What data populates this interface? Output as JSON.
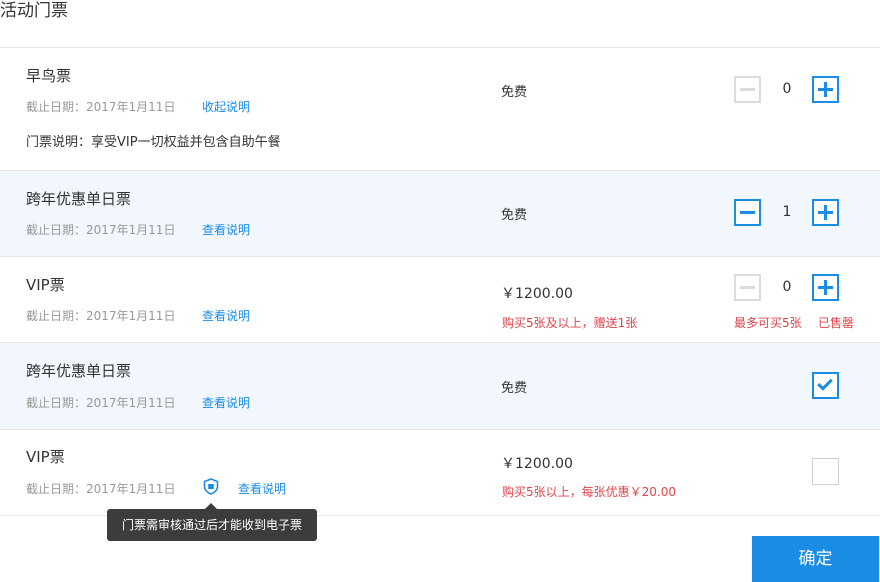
{
  "page": {
    "title": "活动门票"
  },
  "tickets": [
    {
      "name": "早鸟票",
      "deadline": "截止日期：2017年1月11日",
      "link": "收起说明",
      "description": "门票说明：享受VIP一切权益并包含自助午餐",
      "price": "免费",
      "quantity": "0"
    },
    {
      "name": "跨年优惠单日票",
      "deadline": "截止日期：2017年1月11日",
      "link": "查看说明",
      "price": "免费",
      "quantity": "1"
    },
    {
      "name": "VIP票",
      "deadline": "截止日期：2017年1月11日",
      "link": "查看说明",
      "price": "￥1200.00",
      "promo": "购买5张及以上，赠送1张",
      "limit": "最多可买5张",
      "soldout": "已售罄",
      "quantity": "0"
    },
    {
      "name": "跨年优惠单日票",
      "deadline": "截止日期：2017年1月11日",
      "link": "查看说明",
      "price": "免费",
      "checked": true
    },
    {
      "name": "VIP票",
      "deadline": "截止日期：2017年1月11日",
      "link": "查看说明",
      "price": "￥1200.00",
      "promo": "购买5张以上，每张优惠￥20.00",
      "checked": false
    }
  ],
  "tooltip": "门票需审核通过后才能收到电子票",
  "confirm_label": "确定",
  "colors": {
    "accent": "#1a8ce3",
    "highlight_row": "#f1f7fd",
    "warning": "#e0454b"
  }
}
